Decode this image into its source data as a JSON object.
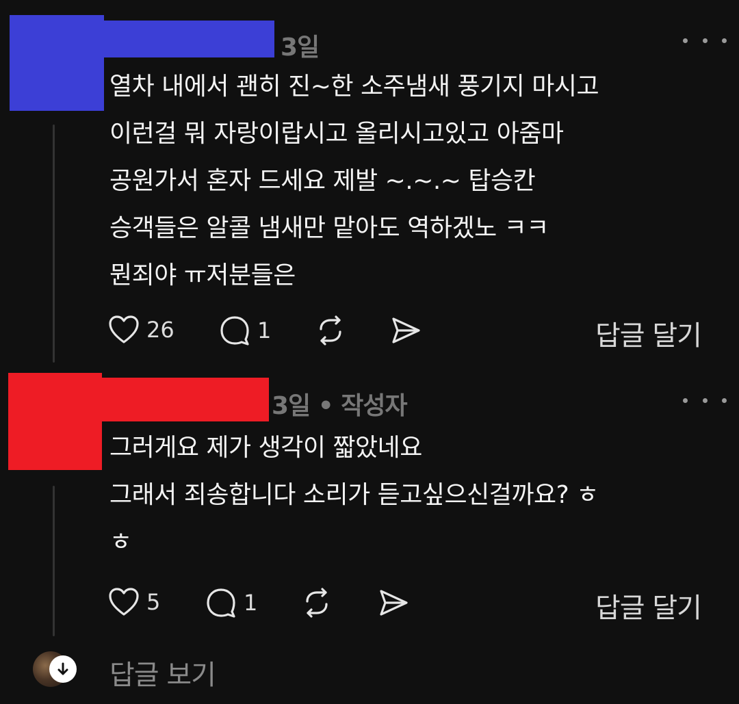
{
  "comments": [
    {
      "time": "3일",
      "author_tag": "",
      "lines": [
        "열차 내에서 괜히 진~한 소주냄새 풍기지 마시고",
        "이런걸 뭐 자랑이랍시고 올리시고있고 아줌마",
        "공원가서 혼자 드세요 제발 ~.~.~ 탑승칸",
        "승객들은 알콜 냄새만 맡아도 역하겠노 ㅋㅋ",
        "뭔죄야 ㅠ저분들은"
      ],
      "likes": "26",
      "replies": "1",
      "reply_label": "답글 달기",
      "redaction_color": "#3c3fd6"
    },
    {
      "time": "3일",
      "author_tag": "• 작성자",
      "lines": [
        "그러게요 제가 생각이 짧았네요",
        "그래서 죄송합니다 소리가 듣고싶으신걸까요? ㅎ",
        "ㅎ"
      ],
      "likes": "5",
      "replies": "1",
      "reply_label": "답글 달기",
      "redaction_color": "#ee1c25"
    }
  ],
  "view_replies_label": "답글 보기",
  "icons": {
    "like": "heart-icon",
    "comment": "comment-bubble-icon",
    "repost": "repost-icon",
    "share": "send-icon",
    "more": "more-dots-icon",
    "expand": "arrow-down-icon"
  }
}
